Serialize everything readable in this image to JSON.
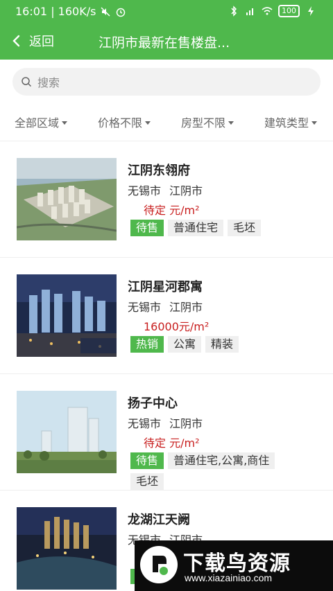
{
  "status_bar": {
    "time_speed": "16:01 | 160K/s",
    "battery": "100"
  },
  "nav": {
    "back_label": "返回",
    "title": "江阴市最新在售楼盘..."
  },
  "search": {
    "placeholder": "搜索"
  },
  "filters": [
    "全部区域",
    "价格不限",
    "房型不限",
    "建筑类型"
  ],
  "listings": [
    {
      "name": "江阴东翎府",
      "city": "无锡市",
      "district": "江阴市",
      "price": "待定 元/m²",
      "status": "待售",
      "tags": [
        "普通住宅",
        "毛坯"
      ]
    },
    {
      "name": "江阴星河郡寓",
      "city": "无锡市",
      "district": "江阴市",
      "price": "16000元/m²",
      "status": "热销",
      "tags": [
        "公寓",
        "精装"
      ]
    },
    {
      "name": "扬子中心",
      "city": "无锡市",
      "district": "江阴市",
      "price": "待定 元/m²",
      "status": "待售",
      "tags": [
        "普通住宅,公寓,商住",
        "毛坯"
      ]
    },
    {
      "name": "龙湖江天阙",
      "city": "无锡市",
      "district": "江阴市",
      "price": "",
      "status": "",
      "tags": []
    }
  ],
  "watermark": {
    "title": "下载鸟资源",
    "url": "www.xiazainiao.com"
  },
  "colors": {
    "brand_green": "#4fb84c",
    "price_red": "#c81e1e"
  }
}
